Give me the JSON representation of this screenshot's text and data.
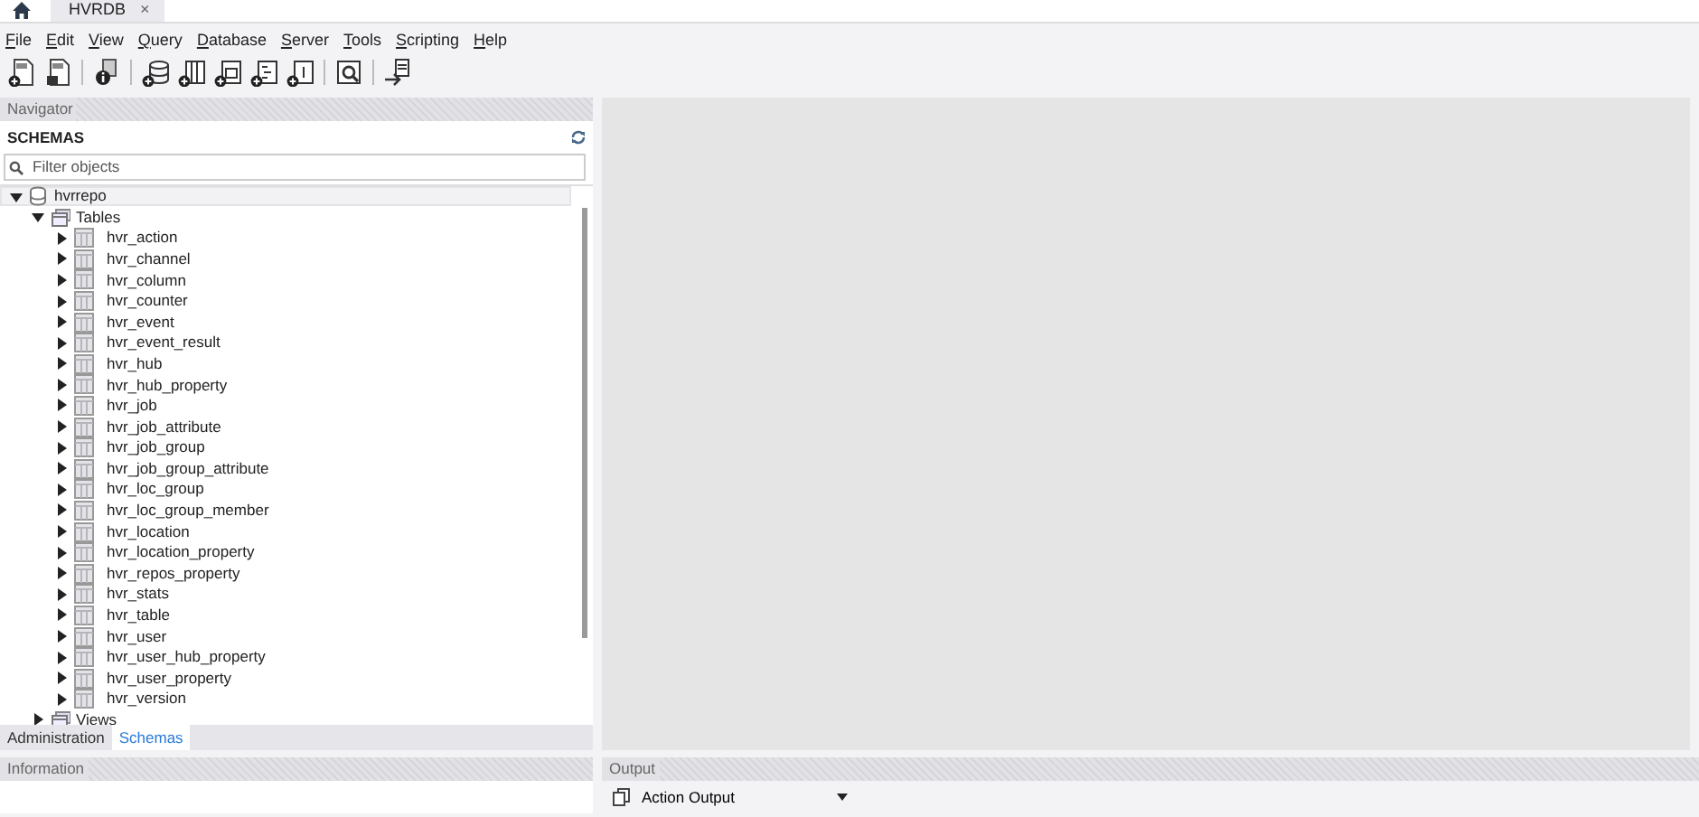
{
  "tabs": [
    {
      "label": "HVRDB",
      "selected": true,
      "close": "×"
    }
  ],
  "menu": [
    "File",
    "Edit",
    "View",
    "Query",
    "Database",
    "Server",
    "Tools",
    "Scripting",
    "Help"
  ],
  "navigator": {
    "title": "Navigator",
    "schemas_title": "SCHEMAS",
    "filter": {
      "placeholder": "Filter objects"
    },
    "tree": [
      {
        "name": "hvrrepo",
        "kind": "schema",
        "expanded": true,
        "children": [
          {
            "name": "Tables",
            "kind": "folder",
            "expanded": true,
            "children": [
              {
                "name": "hvr_action",
                "kind": "table",
                "expanded": false
              },
              {
                "name": "hvr_channel",
                "kind": "table",
                "expanded": false
              },
              {
                "name": "hvr_column",
                "kind": "table",
                "expanded": false
              },
              {
                "name": "hvr_counter",
                "kind": "table",
                "expanded": false
              },
              {
                "name": "hvr_event",
                "kind": "table",
                "expanded": false
              },
              {
                "name": "hvr_event_result",
                "kind": "table",
                "expanded": false
              },
              {
                "name": "hvr_hub",
                "kind": "table",
                "expanded": false
              },
              {
                "name": "hvr_hub_property",
                "kind": "table",
                "expanded": false
              },
              {
                "name": "hvr_job",
                "kind": "table",
                "expanded": false
              },
              {
                "name": "hvr_job_attribute",
                "kind": "table",
                "expanded": false
              },
              {
                "name": "hvr_job_group",
                "kind": "table",
                "expanded": false
              },
              {
                "name": "hvr_job_group_attribute",
                "kind": "table",
                "expanded": false
              },
              {
                "name": "hvr_loc_group",
                "kind": "table",
                "expanded": false
              },
              {
                "name": "hvr_loc_group_member",
                "kind": "table",
                "expanded": false
              },
              {
                "name": "hvr_location",
                "kind": "table",
                "expanded": false
              },
              {
                "name": "hvr_location_property",
                "kind": "table",
                "expanded": false
              },
              {
                "name": "hvr_repos_property",
                "kind": "table",
                "expanded": false
              },
              {
                "name": "hvr_stats",
                "kind": "table",
                "expanded": false
              },
              {
                "name": "hvr_table",
                "kind": "table",
                "expanded": false
              },
              {
                "name": "hvr_user",
                "kind": "table",
                "expanded": false
              },
              {
                "name": "hvr_user_hub_property",
                "kind": "table",
                "expanded": false
              },
              {
                "name": "hvr_user_property",
                "kind": "table",
                "expanded": false
              },
              {
                "name": "hvr_version",
                "kind": "table",
                "expanded": false
              }
            ]
          },
          {
            "name": "Views",
            "kind": "folder",
            "expanded": false
          }
        ]
      }
    ]
  },
  "bottom_tabs": [
    {
      "label": "Administration",
      "selected": false
    },
    {
      "label": "Schemas",
      "selected": true
    }
  ],
  "information": {
    "title": "Information"
  },
  "output": {
    "title": "Output",
    "selector": "Action Output"
  }
}
